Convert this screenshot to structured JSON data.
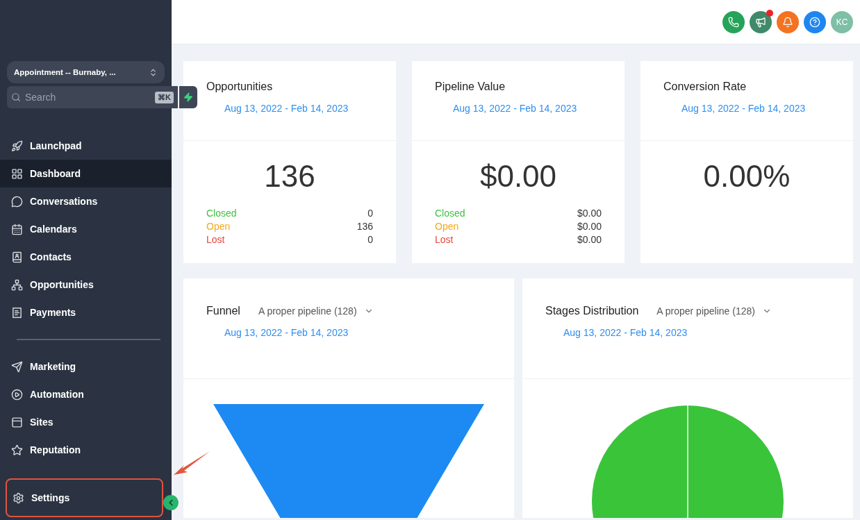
{
  "sidebar": {
    "location": "Appointment -- Burnaby, ...",
    "search": {
      "placeholder": "Search",
      "shortcut": "⌘K"
    },
    "groups": [
      [
        {
          "label": "Launchpad",
          "selected": false
        },
        {
          "label": "Dashboard",
          "selected": true
        },
        {
          "label": "Conversations",
          "selected": false
        },
        {
          "label": "Calendars",
          "selected": false
        },
        {
          "label": "Contacts",
          "selected": false
        },
        {
          "label": "Opportunities",
          "selected": false
        },
        {
          "label": "Payments",
          "selected": false
        }
      ],
      [
        {
          "label": "Marketing",
          "selected": false
        },
        {
          "label": "Automation",
          "selected": false
        },
        {
          "label": "Sites",
          "selected": false
        },
        {
          "label": "Reputation",
          "selected": false
        }
      ]
    ],
    "settings": {
      "label": "Settings",
      "highlighted": true
    }
  },
  "header": {
    "buttons": [
      {
        "kind": "phone",
        "dot": false
      },
      {
        "kind": "megaphone",
        "dot": true
      },
      {
        "kind": "bell",
        "dot": false
      },
      {
        "kind": "help",
        "dot": false
      }
    ],
    "avatar": "KC"
  },
  "stats": [
    {
      "title": "Opportunities",
      "range": "Aug 13, 2022 - Feb 14, 2023",
      "value": "136",
      "rows": [
        {
          "label": "Closed",
          "color": "#3cc23c",
          "value": "0"
        },
        {
          "label": "Open",
          "color": "#f3a81c",
          "value": "136"
        },
        {
          "label": "Lost",
          "color": "#e8453c",
          "value": "0"
        }
      ]
    },
    {
      "title": "Pipeline Value",
      "range": "Aug 13, 2022 - Feb 14, 2023",
      "value": "$0.00",
      "rows": [
        {
          "label": "Closed",
          "color": "#3cc23c",
          "value": "$0.00"
        },
        {
          "label": "Open",
          "color": "#f3a81c",
          "value": "$0.00"
        },
        {
          "label": "Lost",
          "color": "#e8453c",
          "value": "$0.00"
        }
      ]
    },
    {
      "title": "Conversion Rate",
      "range": "Aug 13, 2022 - Feb 14, 2023",
      "value": "0.00%"
    }
  ],
  "charts": [
    {
      "kind": "funnel",
      "title": "Funnel",
      "pipeline": "A proper pipeline (128)",
      "range": "Aug 13, 2022 - Feb 14, 2023"
    },
    {
      "kind": "pie",
      "title": "Stages Distribution",
      "pipeline": "A proper pipeline (128)",
      "range": "Aug 13, 2022 - Feb 14, 2023"
    }
  ]
}
